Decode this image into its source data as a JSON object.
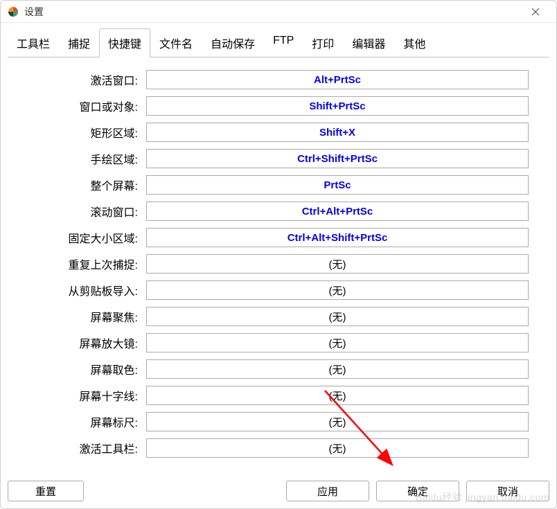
{
  "window": {
    "title": "设置"
  },
  "tabs": {
    "items": [
      {
        "label": "工具栏"
      },
      {
        "label": "捕捉"
      },
      {
        "label": "快捷键"
      },
      {
        "label": "文件名"
      },
      {
        "label": "自动保存"
      },
      {
        "label": "FTP"
      },
      {
        "label": "打印"
      },
      {
        "label": "编辑器"
      },
      {
        "label": "其他"
      }
    ],
    "activeIndex": 2
  },
  "shortcuts": [
    {
      "label": "激活窗口:",
      "value": "Alt+PrtSc",
      "hasValue": true
    },
    {
      "label": "窗口或对象:",
      "value": "Shift+PrtSc",
      "hasValue": true
    },
    {
      "label": "矩形区域:",
      "value": "Shift+X",
      "hasValue": true
    },
    {
      "label": "手绘区域:",
      "value": "Ctrl+Shift+PrtSc",
      "hasValue": true
    },
    {
      "label": "整个屏幕:",
      "value": "PrtSc",
      "hasValue": true
    },
    {
      "label": "滚动窗口:",
      "value": "Ctrl+Alt+PrtSc",
      "hasValue": true
    },
    {
      "label": "固定大小区域:",
      "value": "Ctrl+Alt+Shift+PrtSc",
      "hasValue": true
    },
    {
      "label": "重复上次捕捉:",
      "value": "(无)",
      "hasValue": false
    },
    {
      "label": "从剪贴板导入:",
      "value": "(无)",
      "hasValue": false
    },
    {
      "label": "屏幕聚焦:",
      "value": "(无)",
      "hasValue": false
    },
    {
      "label": "屏幕放大镜:",
      "value": "(无)",
      "hasValue": false
    },
    {
      "label": "屏幕取色:",
      "value": "(无)",
      "hasValue": false
    },
    {
      "label": "屏幕十字线:",
      "value": "(无)",
      "hasValue": false
    },
    {
      "label": "屏幕标尺:",
      "value": "(无)",
      "hasValue": false
    },
    {
      "label": "激活工具栏:",
      "value": "(无)",
      "hasValue": false
    }
  ],
  "buttons": {
    "reset": "重置",
    "apply": "应用",
    "ok": "确定",
    "cancel": "取消"
  },
  "watermark": "Baidu经验 jingyan.baidu.com"
}
